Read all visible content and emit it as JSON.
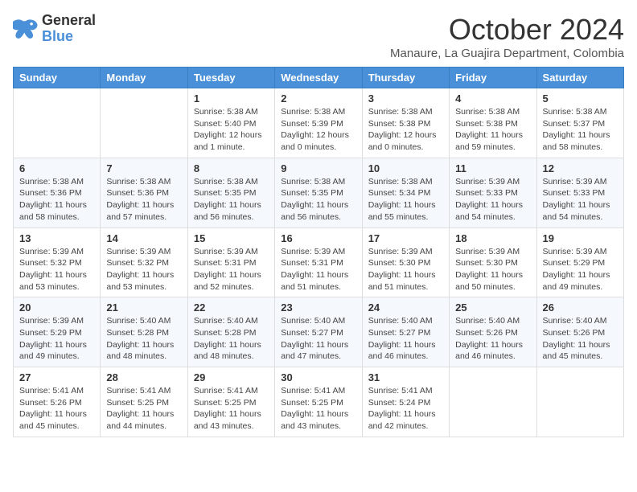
{
  "header": {
    "logo_line1": "General",
    "logo_line2": "Blue",
    "month": "October 2024",
    "location": "Manaure, La Guajira Department, Colombia"
  },
  "weekdays": [
    "Sunday",
    "Monday",
    "Tuesday",
    "Wednesday",
    "Thursday",
    "Friday",
    "Saturday"
  ],
  "weeks": [
    [
      {
        "day": "",
        "info": ""
      },
      {
        "day": "",
        "info": ""
      },
      {
        "day": "1",
        "info": "Sunrise: 5:38 AM\nSunset: 5:40 PM\nDaylight: 12 hours\nand 1 minute."
      },
      {
        "day": "2",
        "info": "Sunrise: 5:38 AM\nSunset: 5:39 PM\nDaylight: 12 hours\nand 0 minutes."
      },
      {
        "day": "3",
        "info": "Sunrise: 5:38 AM\nSunset: 5:38 PM\nDaylight: 12 hours\nand 0 minutes."
      },
      {
        "day": "4",
        "info": "Sunrise: 5:38 AM\nSunset: 5:38 PM\nDaylight: 11 hours\nand 59 minutes."
      },
      {
        "day": "5",
        "info": "Sunrise: 5:38 AM\nSunset: 5:37 PM\nDaylight: 11 hours\nand 58 minutes."
      }
    ],
    [
      {
        "day": "6",
        "info": "Sunrise: 5:38 AM\nSunset: 5:36 PM\nDaylight: 11 hours\nand 58 minutes."
      },
      {
        "day": "7",
        "info": "Sunrise: 5:38 AM\nSunset: 5:36 PM\nDaylight: 11 hours\nand 57 minutes."
      },
      {
        "day": "8",
        "info": "Sunrise: 5:38 AM\nSunset: 5:35 PM\nDaylight: 11 hours\nand 56 minutes."
      },
      {
        "day": "9",
        "info": "Sunrise: 5:38 AM\nSunset: 5:35 PM\nDaylight: 11 hours\nand 56 minutes."
      },
      {
        "day": "10",
        "info": "Sunrise: 5:38 AM\nSunset: 5:34 PM\nDaylight: 11 hours\nand 55 minutes."
      },
      {
        "day": "11",
        "info": "Sunrise: 5:39 AM\nSunset: 5:33 PM\nDaylight: 11 hours\nand 54 minutes."
      },
      {
        "day": "12",
        "info": "Sunrise: 5:39 AM\nSunset: 5:33 PM\nDaylight: 11 hours\nand 54 minutes."
      }
    ],
    [
      {
        "day": "13",
        "info": "Sunrise: 5:39 AM\nSunset: 5:32 PM\nDaylight: 11 hours\nand 53 minutes."
      },
      {
        "day": "14",
        "info": "Sunrise: 5:39 AM\nSunset: 5:32 PM\nDaylight: 11 hours\nand 53 minutes."
      },
      {
        "day": "15",
        "info": "Sunrise: 5:39 AM\nSunset: 5:31 PM\nDaylight: 11 hours\nand 52 minutes."
      },
      {
        "day": "16",
        "info": "Sunrise: 5:39 AM\nSunset: 5:31 PM\nDaylight: 11 hours\nand 51 minutes."
      },
      {
        "day": "17",
        "info": "Sunrise: 5:39 AM\nSunset: 5:30 PM\nDaylight: 11 hours\nand 51 minutes."
      },
      {
        "day": "18",
        "info": "Sunrise: 5:39 AM\nSunset: 5:30 PM\nDaylight: 11 hours\nand 50 minutes."
      },
      {
        "day": "19",
        "info": "Sunrise: 5:39 AM\nSunset: 5:29 PM\nDaylight: 11 hours\nand 49 minutes."
      }
    ],
    [
      {
        "day": "20",
        "info": "Sunrise: 5:39 AM\nSunset: 5:29 PM\nDaylight: 11 hours\nand 49 minutes."
      },
      {
        "day": "21",
        "info": "Sunrise: 5:40 AM\nSunset: 5:28 PM\nDaylight: 11 hours\nand 48 minutes."
      },
      {
        "day": "22",
        "info": "Sunrise: 5:40 AM\nSunset: 5:28 PM\nDaylight: 11 hours\nand 48 minutes."
      },
      {
        "day": "23",
        "info": "Sunrise: 5:40 AM\nSunset: 5:27 PM\nDaylight: 11 hours\nand 47 minutes."
      },
      {
        "day": "24",
        "info": "Sunrise: 5:40 AM\nSunset: 5:27 PM\nDaylight: 11 hours\nand 46 minutes."
      },
      {
        "day": "25",
        "info": "Sunrise: 5:40 AM\nSunset: 5:26 PM\nDaylight: 11 hours\nand 46 minutes."
      },
      {
        "day": "26",
        "info": "Sunrise: 5:40 AM\nSunset: 5:26 PM\nDaylight: 11 hours\nand 45 minutes."
      }
    ],
    [
      {
        "day": "27",
        "info": "Sunrise: 5:41 AM\nSunset: 5:26 PM\nDaylight: 11 hours\nand 45 minutes."
      },
      {
        "day": "28",
        "info": "Sunrise: 5:41 AM\nSunset: 5:25 PM\nDaylight: 11 hours\nand 44 minutes."
      },
      {
        "day": "29",
        "info": "Sunrise: 5:41 AM\nSunset: 5:25 PM\nDaylight: 11 hours\nand 43 minutes."
      },
      {
        "day": "30",
        "info": "Sunrise: 5:41 AM\nSunset: 5:25 PM\nDaylight: 11 hours\nand 43 minutes."
      },
      {
        "day": "31",
        "info": "Sunrise: 5:41 AM\nSunset: 5:24 PM\nDaylight: 11 hours\nand 42 minutes."
      },
      {
        "day": "",
        "info": ""
      },
      {
        "day": "",
        "info": ""
      }
    ]
  ]
}
